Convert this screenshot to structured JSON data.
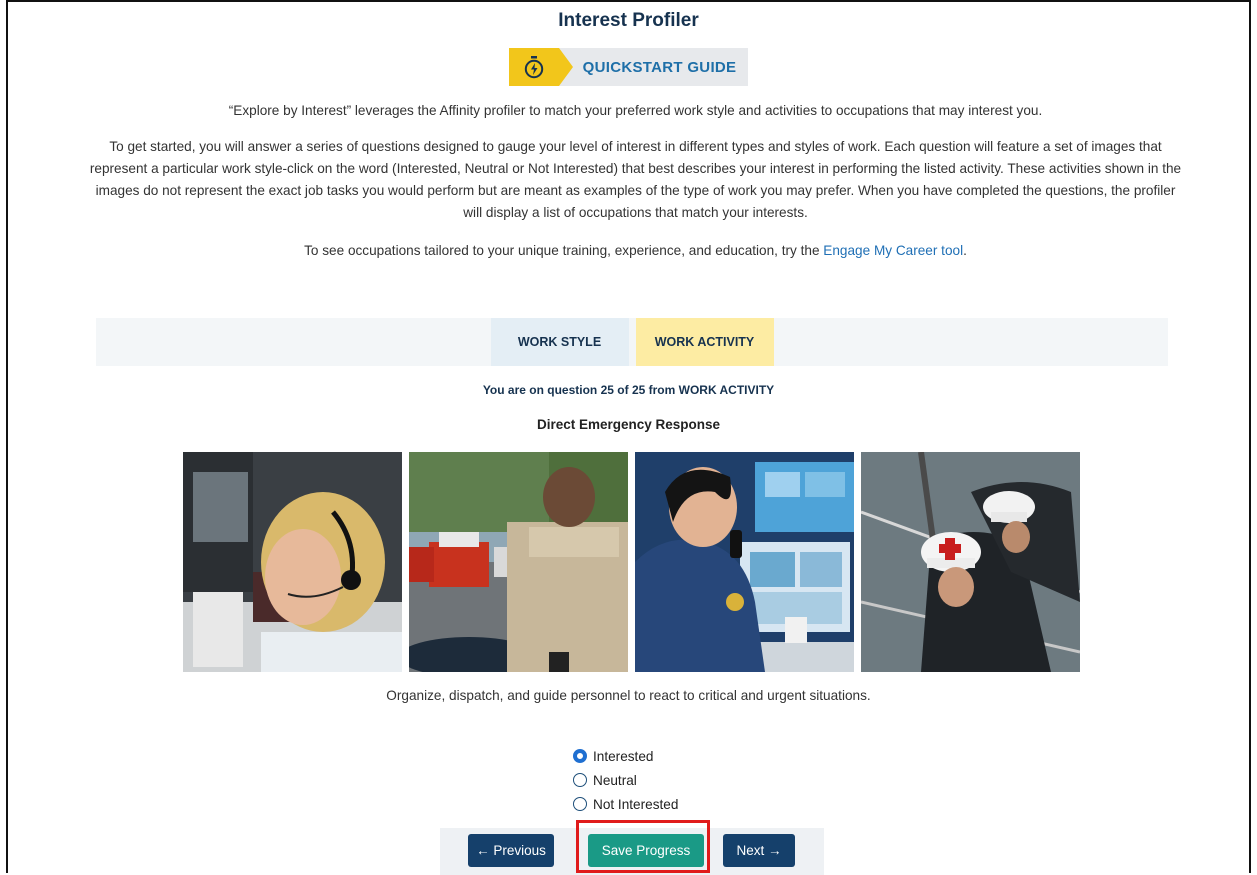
{
  "page": {
    "title": "Interest Profiler",
    "quickstart_label": "QUICKSTART GUIDE",
    "quickstart_icon": "stopwatch-icon"
  },
  "intro": {
    "p1": "“Explore by Interest” leverages the Affinity profiler to match your preferred work style and activities to occupations that may interest you.",
    "p2": "To get started, you will answer a series of questions designed to gauge your level of interest in different types and styles of work. Each question will feature a set of images that represent a particular work style-click on the word (Interested, Neutral or Not Interested) that best describes your interest in performing the listed activity. These activities shown in the images do not represent the exact job tasks you would perform but are meant as examples of the type of work you may prefer. When you have completed the questions, the profiler will display a list of occupations that match your interests.",
    "p3_prefix": "To see occupations tailored to your unique training, experience, and education, try the ",
    "p3_link": "Engage My Career tool",
    "p3_suffix": "."
  },
  "tabs": [
    {
      "label": "WORK STYLE",
      "active": false
    },
    {
      "label": "WORK ACTIVITY",
      "active": true
    }
  ],
  "question": {
    "progress_text": "You are on question 25 of 25 from WORK ACTIVITY",
    "title": "Direct Emergency Response",
    "description": "Organize, dispatch, and guide personnel to react to critical and urgent situations."
  },
  "options": [
    {
      "label": "Interested",
      "checked": true
    },
    {
      "label": "Neutral",
      "checked": false
    },
    {
      "label": "Not Interested",
      "checked": false
    }
  ],
  "buttons": {
    "previous": "← Previous",
    "save": "Save Progress",
    "next": "Next →"
  },
  "colors": {
    "navy": "#15406b",
    "teal": "#1a9a86",
    "accent_yellow": "#f2c61b",
    "link_blue": "#1f6fb5",
    "highlight_red": "#e01b1b"
  }
}
